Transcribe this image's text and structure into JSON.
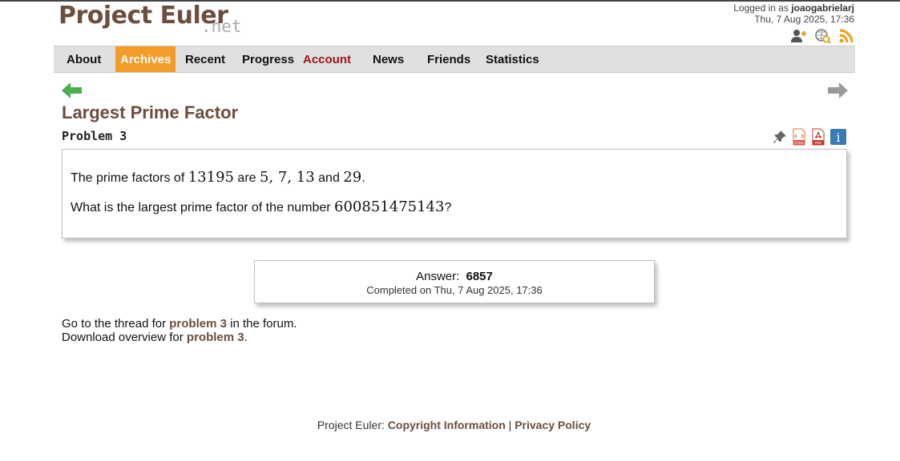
{
  "header": {
    "logo_text": "Project Euler",
    "logo_suffix": ".net",
    "login_prefix": "Logged in as ",
    "username": "joaogabrielarj",
    "datetime": "Thu, 7 Aug 2025, 17:36",
    "icons": [
      "add-friend-icon",
      "globe-search-icon",
      "rss-feed-icon"
    ]
  },
  "nav": {
    "items": [
      {
        "label": "About"
      },
      {
        "label": "Archives",
        "active": true
      },
      {
        "label": "Recent"
      },
      {
        "label": "Progress"
      },
      {
        "label": "Account"
      },
      {
        "label": "News"
      },
      {
        "label": "Friends"
      },
      {
        "label": "Statistics"
      }
    ],
    "active_color": "#f39c28",
    "account_color": "#a01414"
  },
  "problem": {
    "title": "Largest Prime Factor",
    "number_label": "Problem 3",
    "icons": [
      "pin-icon",
      "html-file-icon",
      "pdf-file-icon",
      "info-icon"
    ],
    "icon_labels": {
      "html": "HTML",
      "pdf": "PDF",
      "info": "i"
    },
    "statement": {
      "line1_pre": "The prime factors of ",
      "line1_num": "13195",
      "line1_mid": " are ",
      "line1_factors": "5, 7, 13",
      "line1_and": " and ",
      "line1_last": "29",
      "line1_end": ".",
      "line2_pre": "What is the largest prime factor of the number ",
      "line2_num": "600851475143",
      "line2_end": "?"
    }
  },
  "answer": {
    "label": "Answer:",
    "value": "6857",
    "completed": "Completed on Thu, 7 Aug 2025, 17:36"
  },
  "links": {
    "forum_pre": "Go to the thread for ",
    "forum_link": "problem 3",
    "forum_post": " in the forum.",
    "download_pre": "Download overview for ",
    "download_link": "problem 3",
    "download_post": "."
  },
  "footer": {
    "prefix": "Project Euler: ",
    "copyright": "Copyright Information",
    "separator": " | ",
    "privacy": "Privacy Policy"
  },
  "colors": {
    "brand_brown": "#6b4e3d",
    "nav_bg": "#e0e0e0",
    "green_arrow": "#4caf50",
    "gray_arrow": "#9a9a9a"
  }
}
